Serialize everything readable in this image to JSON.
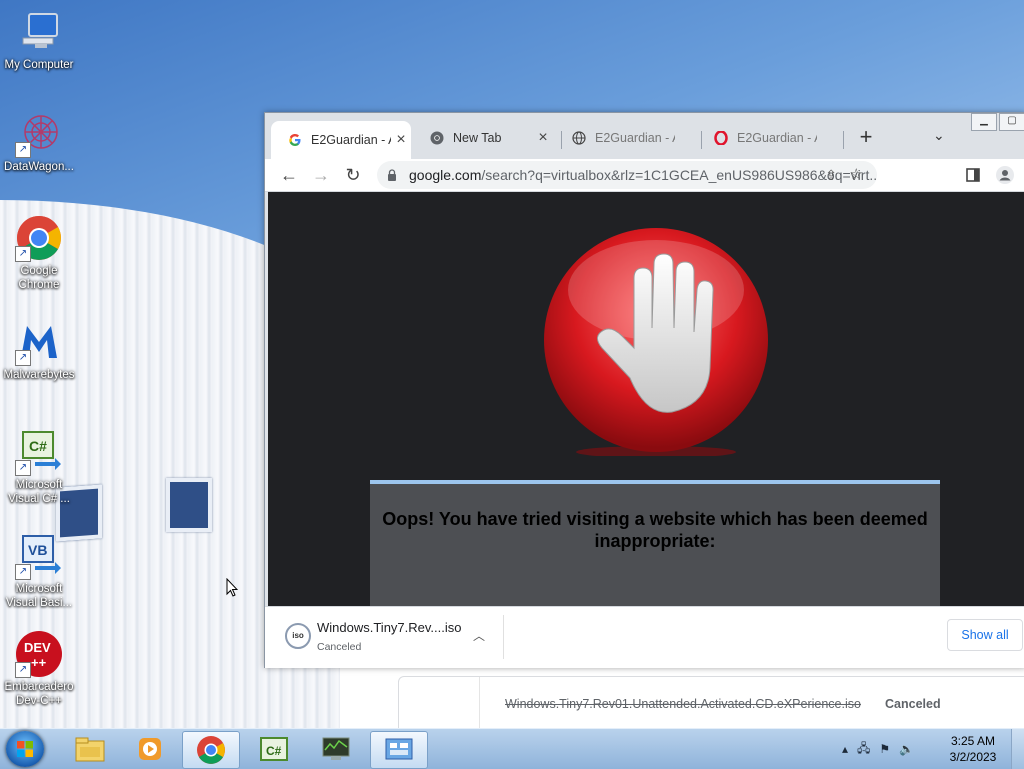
{
  "desktop": {
    "icons": [
      {
        "name": "My Computer"
      },
      {
        "name": "DataWagon..."
      },
      {
        "name": "Google Chrome"
      },
      {
        "name": "Malwarebytes"
      },
      {
        "name": "Microsoft Visual C# ..."
      },
      {
        "name": "Microsoft Visual Basi..."
      },
      {
        "name": "Embarcadero Dev-C++"
      }
    ]
  },
  "browser": {
    "tabs": [
      {
        "title": "E2Guardian - A",
        "icon": "google-g-icon",
        "active": true
      },
      {
        "title": "New Tab",
        "icon": "chrome-icon",
        "active": false
      },
      {
        "title": "E2Guardian - A",
        "icon": "globe-icon",
        "active": false
      },
      {
        "title": "E2Guardian - A",
        "icon": "opera-icon",
        "active": false
      }
    ],
    "address": {
      "host": "google.com",
      "rest": "/search?q=virtualbox&rlz=1C1GCEA_enUS986US986&oq=virt..."
    },
    "block_page": {
      "message": "Oops! You have tried visiting a website which has been deemed inappropriate:"
    },
    "download_bar": {
      "file": "Windows.Tiny7.Rev....iso",
      "status": "Canceled",
      "show_all": "Show all",
      "file_icon_label": "iso"
    }
  },
  "downloads_page": {
    "file": "Windows.Tiny7.Rev01.Unattended.Activated.CD.eXPerience.iso",
    "status": "Canceled"
  },
  "taskbar": {
    "time": "3:25 AM",
    "date": "3/2/2023"
  },
  "colors": {
    "stop_red": "#d8191f",
    "link_blue": "#1a73e8",
    "msg_border": "#9dc6ee"
  }
}
